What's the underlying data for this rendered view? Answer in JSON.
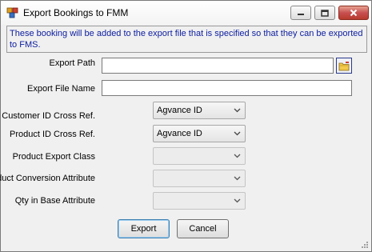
{
  "window": {
    "title": "Export Bookings to FMM",
    "controls": {
      "minimize": "minimize",
      "maximize": "maximize",
      "close": "close"
    }
  },
  "info_text": "These booking will be added to the export file that is specified so that they can be exported to FMS.",
  "fields": {
    "export_path": {
      "label": "Export Path",
      "value": ""
    },
    "export_file_name": {
      "label": "Export File Name",
      "value": ""
    },
    "customer_id_cross_ref": {
      "label": "Customer ID Cross Ref.",
      "value": "Agvance ID"
    },
    "product_id_cross_ref": {
      "label": "Product ID Cross Ref.",
      "value": "Agvance ID"
    },
    "product_export_class": {
      "label": "Product Export Class",
      "value": ""
    },
    "product_conversion_attribute": {
      "label": "Product Conversion Attribute",
      "value": ""
    },
    "qty_in_base_attribute": {
      "label": "Qty in Base Attribute",
      "value": ""
    }
  },
  "buttons": {
    "export": "Export",
    "cancel": "Cancel"
  },
  "icons": {
    "app": "app-icon",
    "browse": "folder-browse-icon",
    "dropdown": "chevron-down-icon"
  },
  "colors": {
    "info_text": "#1020a0",
    "close_button": "#c75050"
  }
}
